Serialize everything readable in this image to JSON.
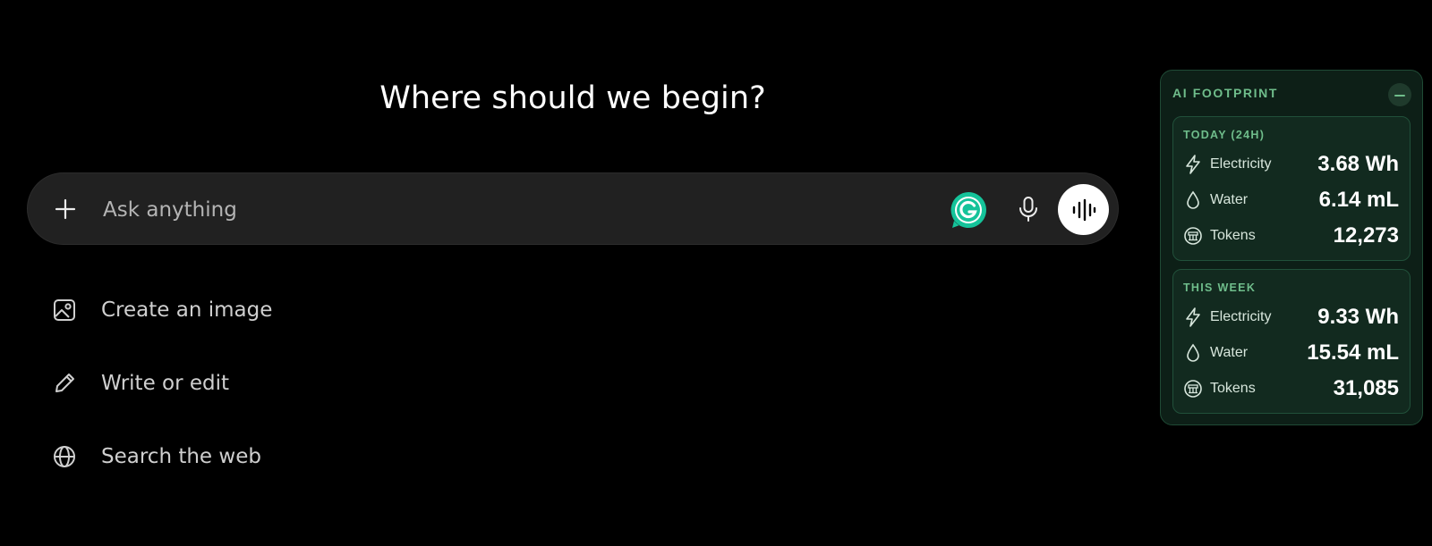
{
  "main": {
    "heading": "Where should we begin?",
    "composer": {
      "placeholder": "Ask anything",
      "add_icon": "plus-icon",
      "grammarly_icon": "grammarly-icon",
      "mic_icon": "microphone-icon",
      "voice_icon": "voice-waveform-icon"
    },
    "suggestions": [
      {
        "label": "Create an image",
        "icon": "image-icon"
      },
      {
        "label": "Write or edit",
        "icon": "pencil-icon"
      },
      {
        "label": "Search the web",
        "icon": "globe-icon"
      }
    ]
  },
  "footprint": {
    "title": "AI FOOTPRINT",
    "minimize_icon": "minimize-icon",
    "today": {
      "title": "TODAY (24H)",
      "rows": [
        {
          "label": "Electricity",
          "value": "3.68 Wh",
          "icon": "lightning-icon"
        },
        {
          "label": "Water",
          "value": "6.14 mL",
          "icon": "droplet-icon"
        },
        {
          "label": "Tokens",
          "value": "12,273",
          "icon": "token-icon"
        }
      ]
    },
    "week": {
      "title": "THIS WEEK",
      "rows": [
        {
          "label": "Electricity",
          "value": "9.33 Wh",
          "icon": "lightning-icon"
        },
        {
          "label": "Water",
          "value": "15.54 mL",
          "icon": "droplet-icon"
        },
        {
          "label": "Tokens",
          "value": "31,085",
          "icon": "token-icon"
        }
      ]
    }
  },
  "colors": {
    "background": "#000000",
    "composer": "#212121",
    "panel": "#0d1f17",
    "panel_accent": "#6fbd8b",
    "grammarly": "#15c39a"
  }
}
